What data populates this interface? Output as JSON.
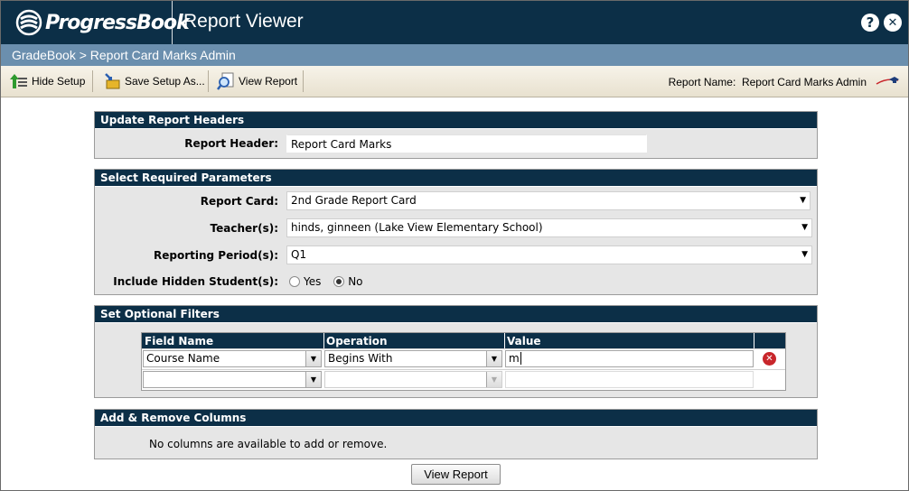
{
  "header": {
    "logo_text": "ProgressBook",
    "app_title": "Report Viewer",
    "help_label": "?",
    "close_label": "✕"
  },
  "breadcrumb": "GradeBook > Report Card Marks Admin",
  "toolbar": {
    "hide_setup": "Hide Setup",
    "save_setup": "Save Setup As...",
    "view_report": "View Report",
    "report_name_label": "Report Name:",
    "report_name_value": "Report Card Marks Admin"
  },
  "update_headers": {
    "title": "Update Report Headers",
    "report_header_label": "Report Header:",
    "report_header_value": "Report Card Marks"
  },
  "required_params": {
    "title": "Select Required Parameters",
    "report_card_label": "Report Card:",
    "report_card_value": "2nd Grade Report Card",
    "teachers_label": "Teacher(s):",
    "teachers_value": "hinds, ginneen (Lake View Elementary School)",
    "reporting_period_label": "Reporting Period(s):",
    "reporting_period_value": "Q1",
    "hidden_students_label": "Include Hidden Student(s):",
    "yes_label": "Yes",
    "no_label": "No",
    "hidden_students_selected": "No"
  },
  "optional_filters": {
    "title": "Set Optional Filters",
    "columns": [
      "Field Name",
      "Operation",
      "Value"
    ],
    "rows": [
      {
        "field": "Course Name",
        "operation": "Begins With",
        "value": "m"
      },
      {
        "field": "",
        "operation": "",
        "value": ""
      }
    ]
  },
  "columns_panel": {
    "title": "Add & Remove Columns",
    "message": "No columns are available to add or remove."
  },
  "view_report_button": "View Report",
  "colors": {
    "header_bg": "#0c2f47",
    "breadcrumb_bg": "#6b8fae",
    "delete_red": "#c8262b"
  }
}
